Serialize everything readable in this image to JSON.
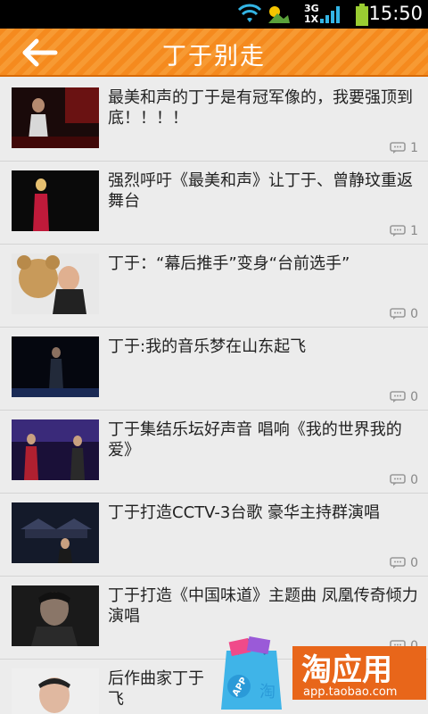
{
  "status_bar": {
    "time": "15:50",
    "network_label": "3G",
    "network_sub_label": "1X",
    "icons": [
      "wifi-icon",
      "weather-icon",
      "cell-signal-icon",
      "battery-icon"
    ]
  },
  "header": {
    "title": "丁于别走",
    "back_icon": "back-arrow-icon"
  },
  "articles": [
    {
      "title": "最美和声的丁于是有冠军像的，我要强顶到底！！！！",
      "comments": "1"
    },
    {
      "title": "强烈呼吁《最美和声》让丁于、曾静玟重返舞台",
      "comments": "1"
    },
    {
      "title": "丁于：“幕后推手”变身“台前选手”",
      "comments": "0"
    },
    {
      "title": "丁于:我的音乐梦在山东起飞",
      "comments": "0"
    },
    {
      "title": "丁于集结乐坛好声音 唱响《我的世界我的爱》",
      "comments": "0"
    },
    {
      "title": "丁于打造CCTV-3台歌 豪华主持群演唱",
      "comments": "0"
    },
    {
      "title": "丁于打造《中国味道》主题曲 凤凰传奇倾力演唱",
      "comments": "0"
    },
    {
      "title": "后作曲家丁于",
      "title_line2": "飞",
      "comments": ""
    }
  ],
  "watermark": {
    "brand": "淘应用",
    "url": "app.taobao.com",
    "bag_label": "APP",
    "bag_char": "淘"
  },
  "colors": {
    "header_orange": "#f58a1e",
    "list_bg": "#ececec",
    "brand_orange": "#e8661a"
  }
}
